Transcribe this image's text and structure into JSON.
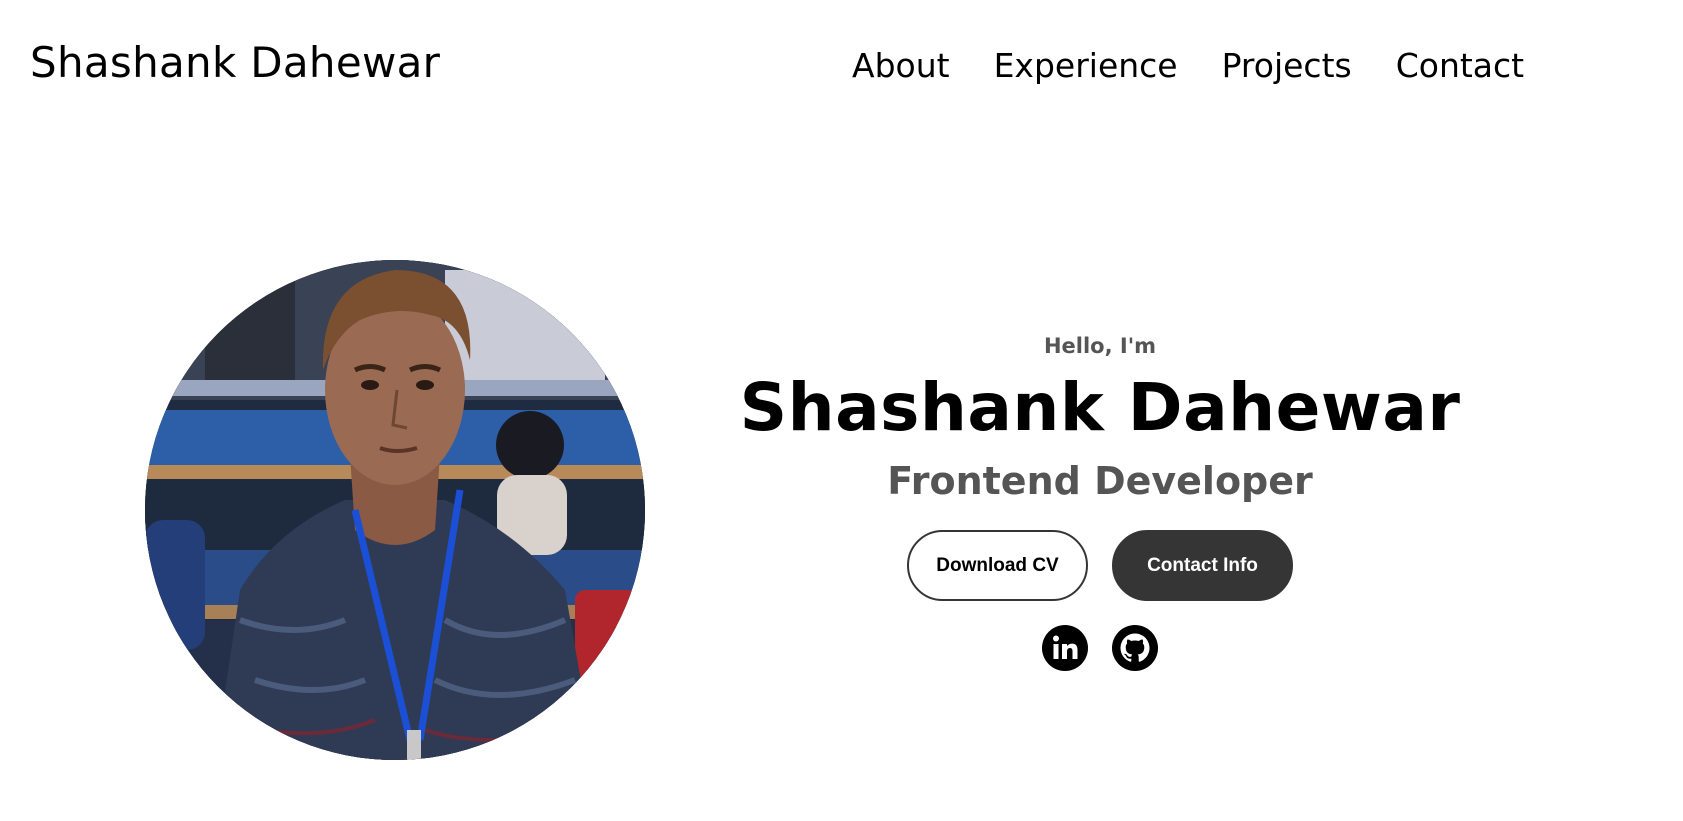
{
  "nav": {
    "brand": "Shashank Dahewar",
    "links": [
      "About",
      "Experience",
      "Projects",
      "Contact"
    ]
  },
  "hero": {
    "greeting": "Hello, I'm",
    "name": "Shashank Dahewar",
    "title": "Frontend Developer",
    "buttons": {
      "download_cv": "Download CV",
      "contact_info": "Contact Info"
    },
    "socials": [
      {
        "icon": "linkedin-icon"
      },
      {
        "icon": "github-icon"
      }
    ]
  },
  "colors": {
    "text": "#000000",
    "muted": "#555555",
    "button_dark": "#353535",
    "background": "#ffffff"
  }
}
